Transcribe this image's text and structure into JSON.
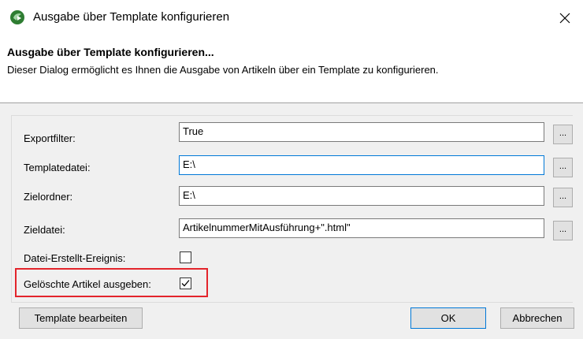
{
  "window": {
    "title": "Ausgabe über Template konfigurieren",
    "icon": "leaf-arrow-app-icon"
  },
  "header": {
    "title": "Ausgabe über Template konfigurieren...",
    "description": "Dieser Dialog ermöglicht es Ihnen die Ausgabe von Artikeln über ein Template zu konfigurieren."
  },
  "fields": {
    "exportfilter": {
      "label": "Exportfilter:",
      "value": "True"
    },
    "templatedatei": {
      "label": "Templatedatei:",
      "value": "E:\\"
    },
    "zielordner": {
      "label": "Zielordner:",
      "value": "E:\\"
    },
    "zieldatei": {
      "label": "Zieldatei:",
      "value": "ArtikelnummerMitAusführung+\".html\""
    }
  },
  "browse_label": "...",
  "checkboxes": {
    "datei_erstellt": {
      "label": "Datei-Erstellt-Ereignis:",
      "checked": false
    },
    "geloeschte": {
      "label": "Gelöschte Artikel ausgeben:",
      "checked": true
    }
  },
  "buttons": {
    "template_bearbeiten": "Template bearbeiten",
    "ok": "OK",
    "abbrechen": "Abbrechen"
  },
  "colors": {
    "highlight": "#e3242b",
    "focus": "#0078d7",
    "dialog_bg": "#f0f0f0"
  }
}
